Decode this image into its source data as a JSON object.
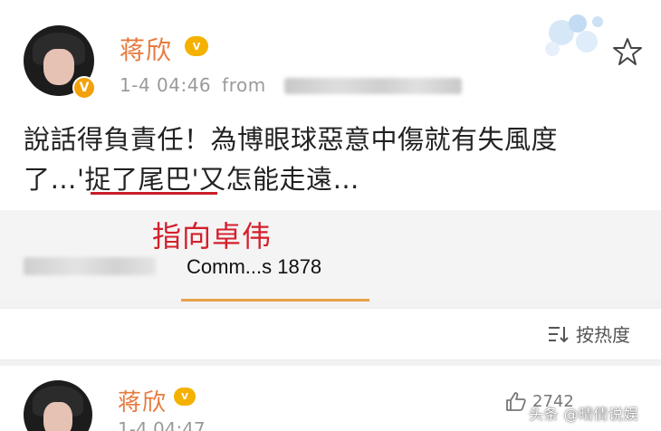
{
  "post": {
    "author": "蒋欣",
    "vip_label": "V",
    "verified_label": "V",
    "time": "1-4 04:46",
    "from_label": "from",
    "content_line1": "說話得負責任！為博眼球惡意中傷就有失風度",
    "content_line2": "了…'捉了尾巴'又怎能走遠…"
  },
  "annotation": {
    "text": "指向卓伟"
  },
  "comments": {
    "count_label": "Comm...s 1878"
  },
  "sort": {
    "label": "按热度"
  },
  "post2": {
    "author": "蒋欣",
    "vip_label": "V",
    "time_partial": "1-4 04:47",
    "like_count": "2742"
  },
  "watermark": {
    "text": "头条 @晴倩说娱"
  },
  "colors": {
    "name": "#e77a3e",
    "annotation": "#d4202c",
    "underline_red": "#c81e28",
    "underline_orange": "#e8a24a",
    "badge": "#f5b100"
  },
  "icons": {
    "favorite": "star-outline-icon",
    "sort": "sort-icon",
    "like": "thumbs-up-icon"
  }
}
